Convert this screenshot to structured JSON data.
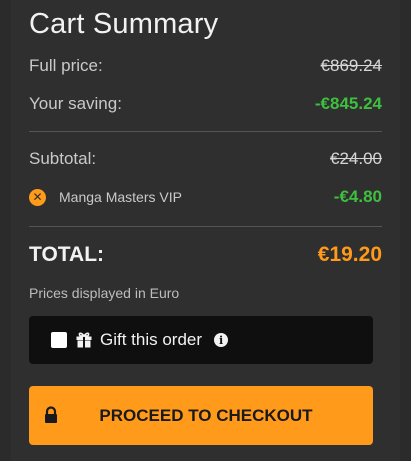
{
  "summary": {
    "title": "Cart Summary",
    "full_price_label": "Full price:",
    "full_price_value": "€869.24",
    "saving_label": "Your saving:",
    "saving_value": "-€845.24",
    "subtotal_label": "Subtotal:",
    "subtotal_value": "€24.00",
    "discount_label": "Manga Masters VIP",
    "discount_value": "-€4.80",
    "total_label": "TOTAL:",
    "total_value": "€19.20",
    "currency_note": "Prices displayed in Euro"
  },
  "gift": {
    "label": "Gift this order",
    "checked": false
  },
  "checkout": {
    "label": "PROCEED TO CHECKOUT"
  },
  "colors": {
    "accent": "#ff9a1a",
    "positive": "#3fbf3f",
    "panel": "#2f2f2f"
  },
  "icons": {
    "remove": "x-circle-icon",
    "gift": "gift-icon",
    "info": "info-icon",
    "lock": "lock-icon"
  }
}
